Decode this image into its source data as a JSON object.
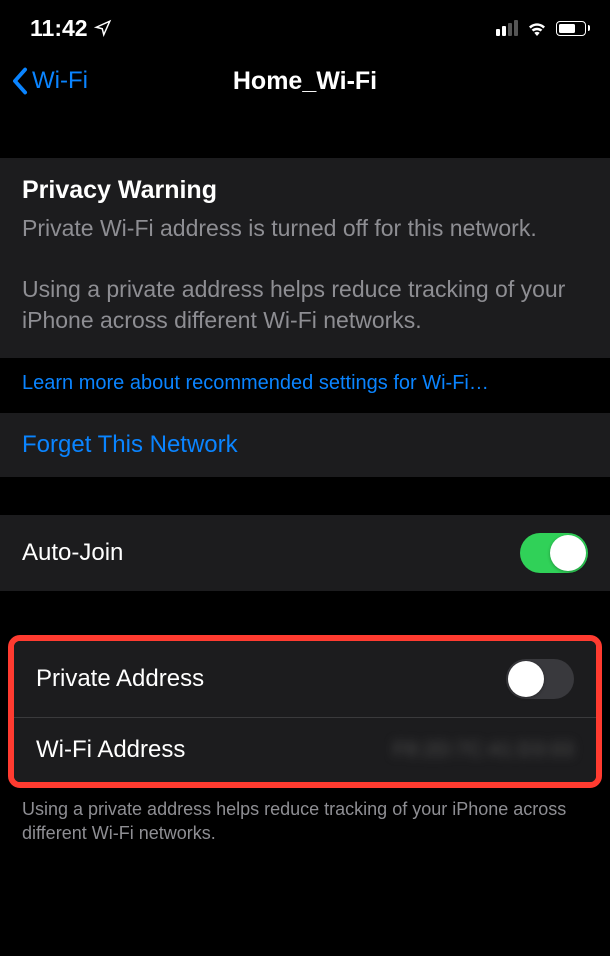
{
  "statusBar": {
    "time": "11:42"
  },
  "nav": {
    "back": "Wi-Fi",
    "title": "Home_Wi-Fi"
  },
  "privacy": {
    "title": "Privacy Warning",
    "line1": "Private Wi-Fi address is turned off for this network.",
    "line2": "Using a private address helps reduce tracking of your iPhone across different Wi-Fi networks."
  },
  "learnMore": "Learn more about recommended settings for Wi-Fi…",
  "forget": "Forget This Network",
  "autoJoin": {
    "label": "Auto-Join"
  },
  "privateAddress": {
    "label": "Private Address"
  },
  "wifiAddress": {
    "label": "Wi-Fi Address",
    "value": "F8:2D:7C:41:D3:03"
  },
  "footer": "Using a private address helps reduce tracking of your iPhone across different Wi-Fi networks."
}
